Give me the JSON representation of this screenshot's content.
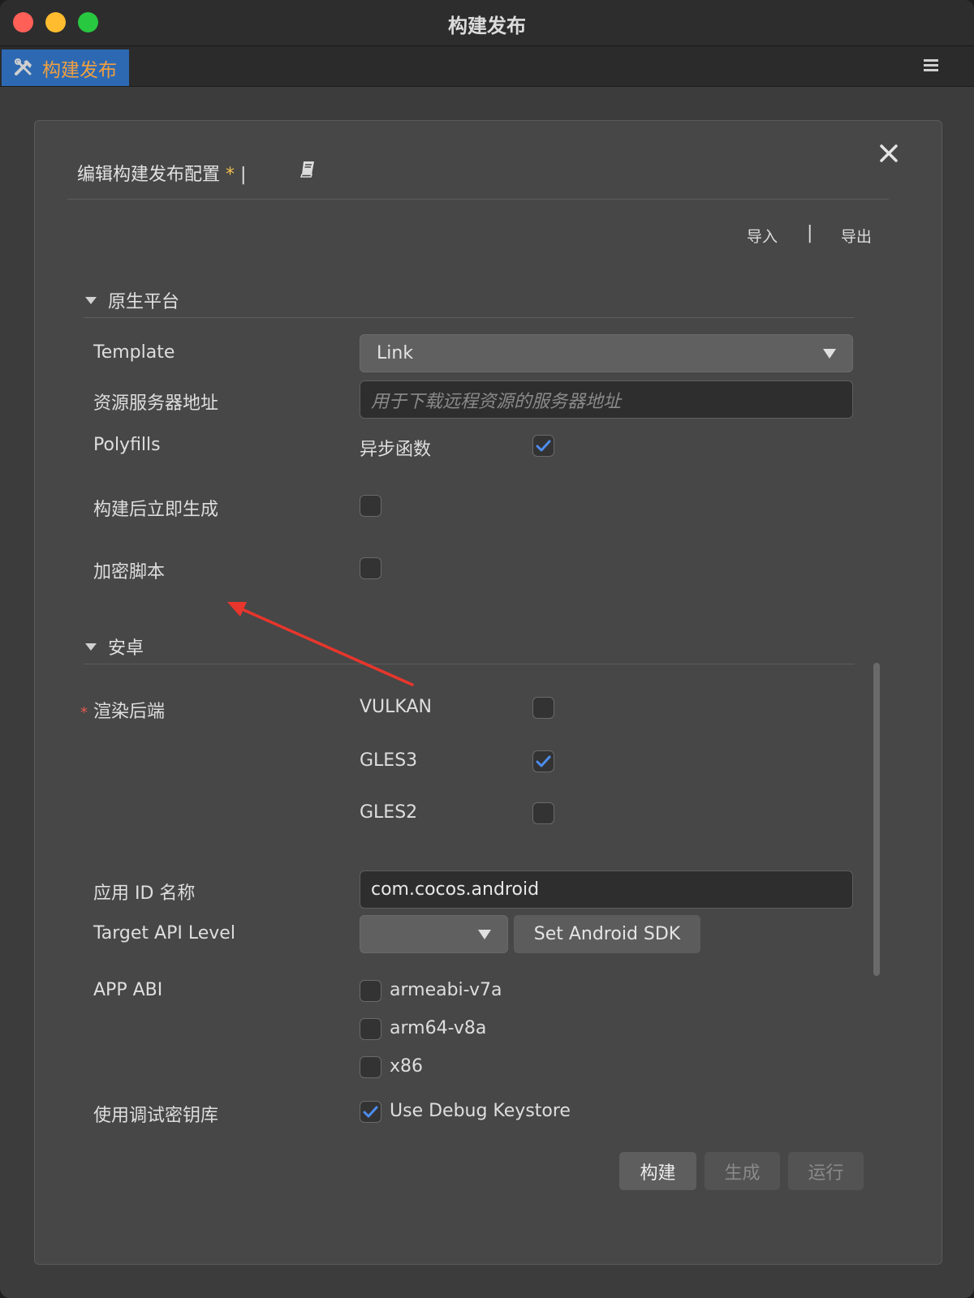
{
  "window": {
    "title": "构建发布"
  },
  "tab": {
    "label": "构建发布",
    "icon": "tools-icon"
  },
  "dialog": {
    "title": "编辑构建发布配置",
    "modified_marker": "*",
    "separator": "|",
    "import_label": "导入",
    "link_separator": "|",
    "export_label": "导出"
  },
  "native": {
    "header": "原生平台",
    "template_label": "Template",
    "template_value": "Link",
    "server_label": "资源服务器地址",
    "server_placeholder": "用于下载远程资源的服务器地址",
    "polyfills_label": "Polyfills",
    "async_label": "异步函数",
    "async_checked": true,
    "make_after_build_label": "构建后立即生成",
    "make_after_build_checked": false,
    "encrypt_label": "加密脚本",
    "encrypt_checked": false
  },
  "android": {
    "header": "安卓",
    "required_marker": "*",
    "render_backend_label": "渲染后端",
    "backends": [
      {
        "name": "VULKAN",
        "checked": false
      },
      {
        "name": "GLES3",
        "checked": true
      },
      {
        "name": "GLES2",
        "checked": false
      }
    ],
    "app_id_label": "应用 ID 名称",
    "app_id_value": "com.cocos.android",
    "target_api_label": "Target API Level",
    "target_api_value": "",
    "set_sdk_label": "Set Android SDK",
    "abi_label": "APP ABI",
    "abis": [
      {
        "name": "armeabi-v7a",
        "checked": false
      },
      {
        "name": "arm64-v8a",
        "checked": false
      },
      {
        "name": "x86",
        "checked": false
      }
    ],
    "debug_keystore_label": "使用调试密钥库",
    "debug_keystore_option": "Use Debug Keystore",
    "debug_keystore_checked": true
  },
  "actions": {
    "build": "构建",
    "make": "生成",
    "run": "运行"
  },
  "colors": {
    "tab_active": "#2d69b3",
    "tab_text": "#f0a040",
    "check_accent": "#4d8df0",
    "annotation_arrow": "#e8362c"
  }
}
